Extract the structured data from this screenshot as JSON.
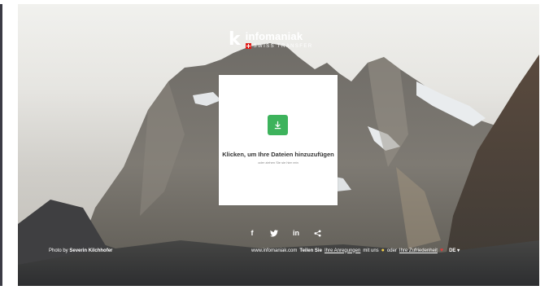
{
  "logo": {
    "letter": "k",
    "name": "infomaniak",
    "subtitle": "SWISS TRANSFER"
  },
  "upload": {
    "title": "Klicken, um Ihre Dateien hinzuzufügen",
    "subtitle": "oder ziehen Sie sie hier rein",
    "icon": "download-arrow-icon",
    "button_color": "#3db35c"
  },
  "social": {
    "facebook": "f",
    "twitter": "twitter-icon",
    "linkedin": "in",
    "share": "share-icon"
  },
  "footer": {
    "credit_prefix": "Photo by",
    "credit_author": "Severin Kilchhofer",
    "site": "www.infomaniak.com",
    "share_prefix": "Teilen Sie",
    "feedback_link": "Ihre Anregungen",
    "with_us": "mit uns",
    "or": "oder",
    "satisfaction_link": "Ihre Zufriedenheit",
    "language": "DE"
  },
  "colors": {
    "accent_green": "#3db35c",
    "heart_red": "#e03a3a",
    "bulb_yellow": "#f6d24a"
  }
}
